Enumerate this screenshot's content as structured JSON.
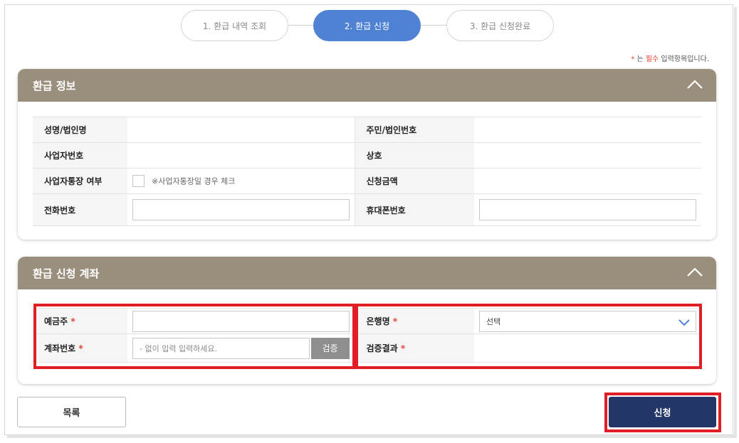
{
  "steps": [
    {
      "label": "1. 환급 내역 조회",
      "active": false
    },
    {
      "label": "2. 환급 신청",
      "active": true
    },
    {
      "label": "3. 환급 신청완료",
      "active": false
    }
  ],
  "required_note": {
    "star": "*",
    "prefix": " 는 ",
    "keyword": "필수",
    "suffix": " 입력항목입니다."
  },
  "refund_info": {
    "title": "환급 정보",
    "labels": {
      "name": "성명/법인명",
      "id_number": "주민/법인번호",
      "business_number": "사업자번호",
      "trade_name": "상호",
      "business_account": "사업자통장 여부",
      "requested_amount": "신청금액",
      "phone": "전화번호",
      "mobile": "휴대폰번호"
    },
    "business_account_note": "※사업자통장일 경우 체크",
    "values": {
      "name": "",
      "id_number": "",
      "business_number": "",
      "trade_name": "",
      "requested_amount": "",
      "phone": "",
      "mobile": ""
    }
  },
  "refund_account": {
    "title": "환급 신청 계좌",
    "labels": {
      "depositor": "예금주",
      "bank_name": "은행명",
      "account_number": "계좌번호",
      "verify_result": "검증결과"
    },
    "required_mark": "*",
    "values": {
      "depositor": "",
      "bank_selected": "선택",
      "account_number": "",
      "verify_result": ""
    },
    "account_placeholder": "- 없이 입력 입력하세요.",
    "verify_button": "검증"
  },
  "buttons": {
    "list": "목록",
    "apply": "신청"
  },
  "colors": {
    "accent": "#4f82d2",
    "panel_header": "#9a8e7d",
    "apply_button": "#233668",
    "highlight": "#e01e26",
    "required": "#e8412c"
  },
  "icons": {
    "collapse": "chevron-up-icon",
    "dropdown": "chevron-down-icon"
  }
}
